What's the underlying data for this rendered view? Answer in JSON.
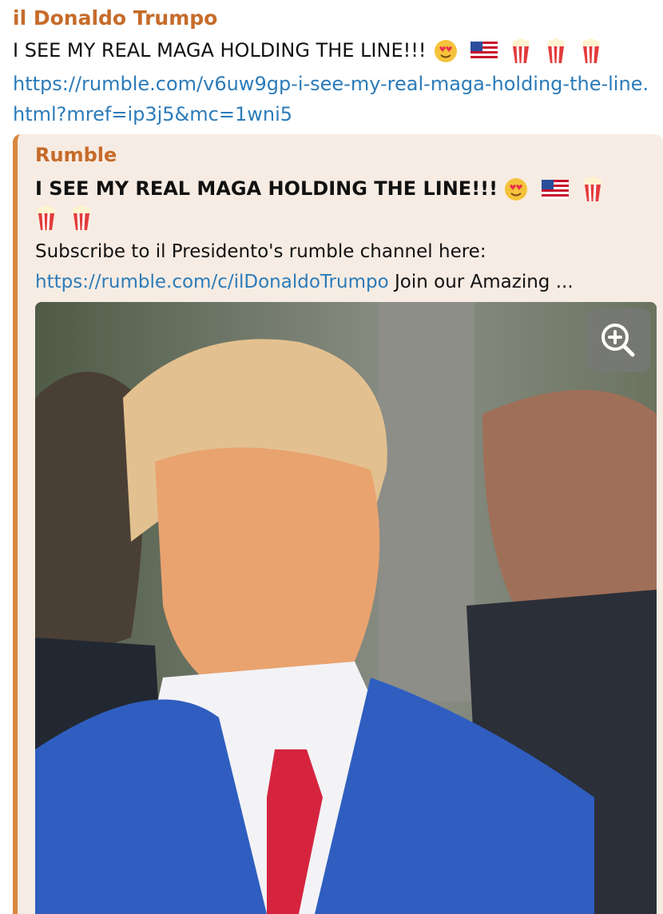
{
  "message": {
    "sender": "il Donaldo Trumpo",
    "text": "I SEE MY REAL MAGA HOLDING THE LINE!!!",
    "emojis": [
      "heart-eyes-emoji",
      "us-flag-emoji",
      "popcorn-emoji",
      "popcorn-emoji",
      "popcorn-emoji"
    ],
    "link": "https://rumble.com/v6uw9gp-i-see-my-real-maga-holding-the-line.html?mref=ip3j5&mc=1wni5"
  },
  "preview": {
    "site_name": "Rumble",
    "title": "I SEE MY REAL MAGA HOLDING THE LINE!!!",
    "title_emojis": [
      "heart-eyes-emoji",
      "us-flag-emoji",
      "popcorn-emoji",
      "popcorn-emoji",
      "popcorn-emoji"
    ],
    "description": "Subscribe to il Presidento's rumble channel here:",
    "description_link": "https://rumble.com/c/ilDonaldoTrumpo",
    "description_tail": " Join our Amazing ...",
    "media_alt": "Photo of a man in a blue suit with red tie in a crowd",
    "zoom_icon": "zoom-in-icon"
  },
  "colors": {
    "sender": "#c66b2a",
    "link": "#2b7bb9",
    "preview_bg": "#f7ece3",
    "preview_bar": "#d8873f"
  }
}
